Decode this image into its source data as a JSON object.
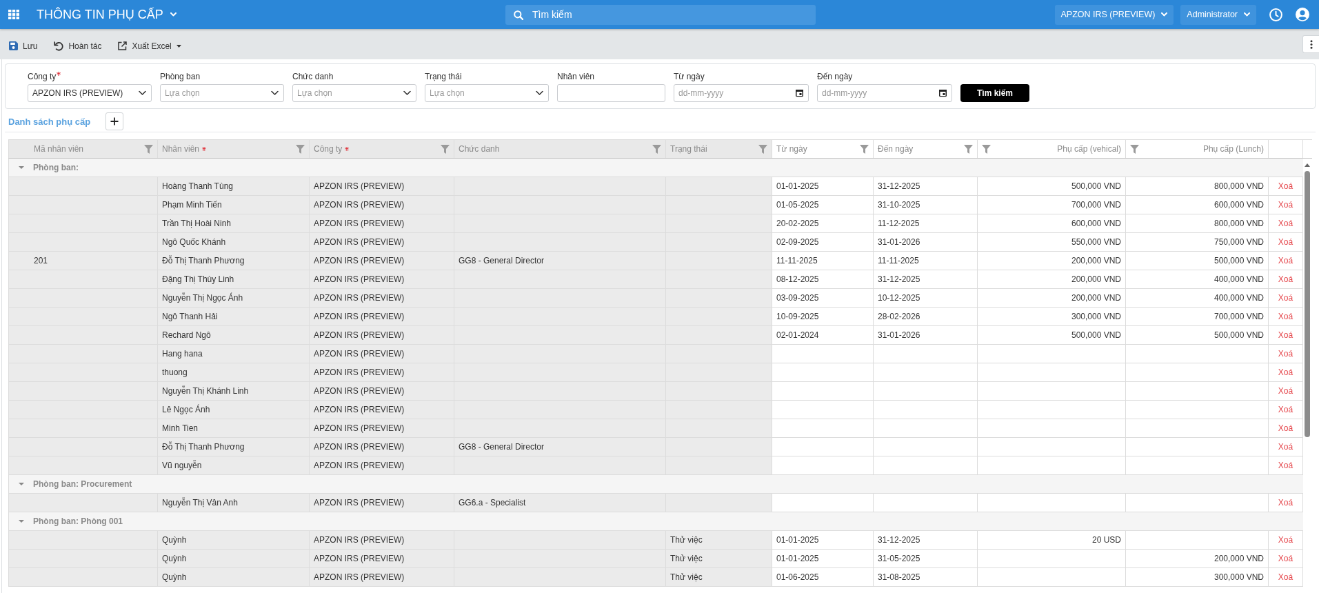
{
  "app_bar": {
    "title": "THÔNG TIN PHỤ CẤP",
    "search": {
      "placeholder": "Tìm kiếm"
    },
    "company_menu": "APZON IRS (PREVIEW)",
    "user_menu": "Administrator"
  },
  "toolbar": {
    "buttons": [
      {
        "kind": "save",
        "label": "Lưu"
      },
      {
        "kind": "undo",
        "label": "Hoàn tác"
      },
      {
        "kind": "export",
        "label": "Xuất Excel"
      }
    ]
  },
  "filters": {
    "fields": [
      {
        "label": "Công ty",
        "required": true,
        "kind": "select",
        "value": "APZON IRS (PREVIEW)"
      },
      {
        "label": "Phòng ban",
        "required": false,
        "kind": "select",
        "placeholder": "Lựa chọn"
      },
      {
        "label": "Chức danh",
        "required": false,
        "kind": "select",
        "placeholder": "Lựa chọn"
      },
      {
        "label": "Trạng thái",
        "required": false,
        "kind": "select",
        "placeholder": "Lựa chọn"
      },
      {
        "label": "Nhân viên",
        "required": false,
        "kind": "text"
      },
      {
        "label": "Từ ngày",
        "required": false,
        "kind": "date",
        "placeholder": "dd-mm-yyyy"
      },
      {
        "label": "Đến ngày",
        "required": false,
        "kind": "date",
        "placeholder": "dd-mm-yyyy"
      }
    ],
    "search_button": "Tìm kiếm"
  },
  "list": {
    "title": "Danh sách phụ cấp"
  },
  "table": {
    "columns": [
      {
        "label": "Mã nhân viên",
        "required": false,
        "readonly": true,
        "kind": "text"
      },
      {
        "label": "Nhân viên",
        "required": true,
        "readonly": true,
        "kind": "text"
      },
      {
        "label": "Công ty",
        "required": true,
        "readonly": true,
        "kind": "text"
      },
      {
        "label": "Chức danh",
        "required": false,
        "readonly": true,
        "kind": "text"
      },
      {
        "label": "Trạng thái",
        "required": false,
        "readonly": true,
        "kind": "text"
      },
      {
        "label": "Từ ngày",
        "required": false,
        "readonly": false,
        "kind": "date"
      },
      {
        "label": "Đến ngày",
        "required": false,
        "readonly": false,
        "kind": "date"
      },
      {
        "label": "Phụ cấp (vehical)",
        "required": false,
        "readonly": false,
        "kind": "money"
      },
      {
        "label": "Phụ cấp (Lunch)",
        "required": false,
        "readonly": false,
        "kind": "money"
      }
    ],
    "groups": [
      {
        "label": "Phòng ban:",
        "expanded": true,
        "rows": [
          {
            "employee": "Hoàng Thanh Tùng",
            "company": "APZON IRS (PREVIEW)",
            "from_date": "01-01-2025",
            "to_date": "31-12-2025",
            "vehicle_allowance": "500,000 VND",
            "lunch_allowance": "800,000 VND",
            "action": "Xoá"
          },
          {
            "employee": "Phạm Minh Tiến",
            "company": "APZON IRS (PREVIEW)",
            "from_date": "01-05-2025",
            "to_date": "31-10-2025",
            "vehicle_allowance": "700,000 VND",
            "lunch_allowance": "600,000 VND",
            "action": "Xoá"
          },
          {
            "employee": "Trần Thị Hoài Ninh",
            "company": "APZON IRS (PREVIEW)",
            "from_date": "20-02-2025",
            "to_date": "11-12-2025",
            "vehicle_allowance": "600,000 VND",
            "lunch_allowance": "800,000 VND",
            "action": "Xoá"
          },
          {
            "employee": "Ngô Quốc Khánh",
            "company": "APZON IRS (PREVIEW)",
            "from_date": "02-09-2025",
            "to_date": "31-01-2026",
            "vehicle_allowance": "550,000 VND",
            "lunch_allowance": "750,000 VND",
            "action": "Xoá"
          },
          {
            "employee_code": "201",
            "employee": "Đỗ Thị Thanh Phương",
            "company": "APZON IRS (PREVIEW)",
            "job_title": "GG8 - General Director",
            "from_date": "11-11-2025",
            "to_date": "11-11-2025",
            "vehicle_allowance": "200,000 VND",
            "lunch_allowance": "500,000 VND",
            "action": "Xoá"
          },
          {
            "employee": "Đặng Thị Thùy Linh",
            "company": "APZON IRS (PREVIEW)",
            "from_date": "08-12-2025",
            "to_date": "31-12-2025",
            "vehicle_allowance": "200,000 VND",
            "lunch_allowance": "400,000 VND",
            "action": "Xoá"
          },
          {
            "employee": "Nguyễn Thị Ngọc Ánh",
            "company": "APZON IRS (PREVIEW)",
            "from_date": "03-09-2025",
            "to_date": "10-12-2025",
            "vehicle_allowance": "200,000 VND",
            "lunch_allowance": "400,000 VND",
            "action": "Xoá"
          },
          {
            "employee": "Ngô Thanh Hải",
            "company": "APZON IRS (PREVIEW)",
            "from_date": "10-09-2025",
            "to_date": "28-02-2026",
            "vehicle_allowance": "300,000 VND",
            "lunch_allowance": "700,000 VND",
            "action": "Xoá"
          },
          {
            "employee": "Rechard Ngô",
            "company": "APZON IRS (PREVIEW)",
            "from_date": "02-01-2024",
            "to_date": "31-01-2026",
            "vehicle_allowance": "500,000 VND",
            "lunch_allowance": "500,000 VND",
            "action": "Xoá"
          },
          {
            "employee": "Hang hana",
            "company": "APZON IRS (PREVIEW)",
            "action": "Xoá"
          },
          {
            "employee": "thuong",
            "company": "APZON IRS (PREVIEW)",
            "action": "Xoá"
          },
          {
            "employee": "Nguyễn Thị Khánh Linh",
            "company": "APZON IRS (PREVIEW)",
            "action": "Xoá"
          },
          {
            "employee": "Lê Ngọc Ánh",
            "company": "APZON IRS (PREVIEW)",
            "action": "Xoá"
          },
          {
            "employee": "Minh Tien",
            "company": "APZON IRS (PREVIEW)",
            "action": "Xoá"
          },
          {
            "employee": "Đỗ Thị Thanh Phương",
            "company": "APZON IRS (PREVIEW)",
            "job_title": "GG8 - General Director",
            "action": "Xoá"
          },
          {
            "employee": "Vũ nguyễn",
            "company": "APZON IRS (PREVIEW)",
            "action": "Xoá"
          }
        ]
      },
      {
        "label": "Phòng ban: Procurement",
        "expanded": true,
        "rows": [
          {
            "employee": "Nguyễn Thị Vân Anh",
            "company": "APZON IRS (PREVIEW)",
            "job_title": "GG6.a - Specialist",
            "action": "Xoá"
          }
        ]
      },
      {
        "label": "Phòng ban: Phòng 001",
        "expanded": true,
        "rows": [
          {
            "employee": "Quỳnh",
            "company": "APZON IRS (PREVIEW)",
            "status": "Thử việc",
            "from_date": "01-01-2025",
            "to_date": "31-12-2025",
            "vehicle_allowance": "20 USD",
            "action": "Xoá"
          },
          {
            "employee": "Quỳnh",
            "company": "APZON IRS (PREVIEW)",
            "status": "Thử việc",
            "from_date": "01-01-2025",
            "to_date": "31-05-2025",
            "lunch_allowance": "200,000 VND",
            "action": "Xoá"
          },
          {
            "employee": "Quỳnh",
            "company": "APZON IRS (PREVIEW)",
            "status": "Thử việc",
            "from_date": "01-06-2025",
            "to_date": "31-08-2025",
            "lunch_allowance": "300,000 VND",
            "action": "Xoá"
          }
        ]
      }
    ]
  }
}
